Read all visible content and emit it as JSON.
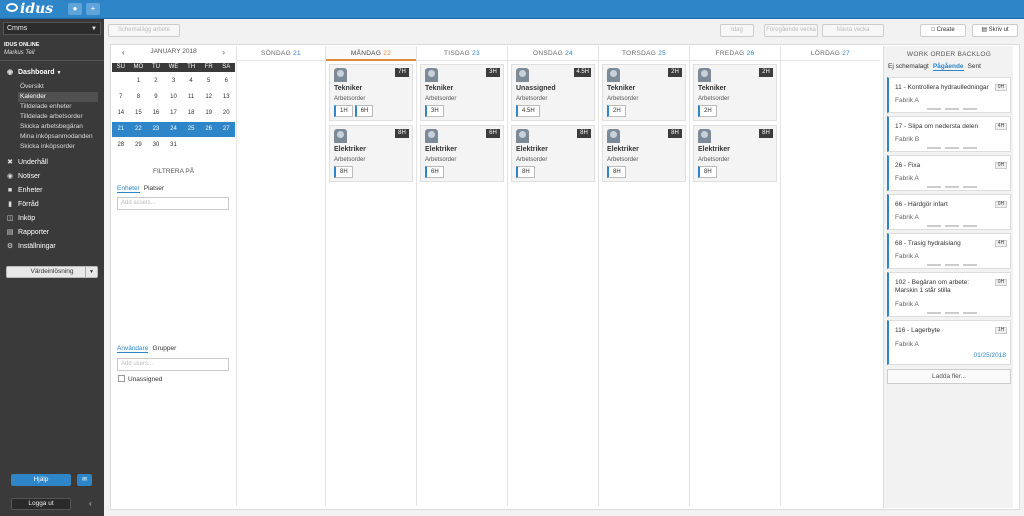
{
  "app": {
    "logo": "idus"
  },
  "sidebar": {
    "module": "Cmms",
    "org": "IDUS ONLINE",
    "user": "Markus Teil",
    "dashboard": "Dashboard",
    "subitems": [
      "Översikt",
      "Kalender",
      "Tilldelade enheter",
      "Tilldelade arbetsorder",
      "Skicka arbetsbegäran",
      "Mina inköpsanmodanden",
      "Skicka inköpsorder"
    ],
    "items": [
      {
        "label": "Underhåll",
        "icon": "tools-icon"
      },
      {
        "label": "Notiser",
        "icon": "bell-icon"
      },
      {
        "label": "Enheter",
        "icon": "assets-icon"
      },
      {
        "label": "Förråd",
        "icon": "truck-icon"
      },
      {
        "label": "Inköp",
        "icon": "cart-icon"
      },
      {
        "label": "Rapporter",
        "icon": "report-icon"
      },
      {
        "label": "Inställningar",
        "icon": "gear-icon"
      }
    ],
    "value_button": "Värdeinlösning",
    "help": "Hjälp",
    "logout": "Logga ut"
  },
  "toolbar": {
    "left_button": "Schemalägg arbete",
    "btn_idag": "Idag",
    "btn_prev": "Föregående vecka",
    "btn_next": "Nästa vecka",
    "create": "Create",
    "print": "Skriv ut"
  },
  "calendar": {
    "month": "JANUARY 2018",
    "dow": [
      "SU",
      "MO",
      "TU",
      "WE",
      "TH",
      "FR",
      "SA"
    ],
    "weeks": [
      [
        "",
        "1",
        "2",
        "3",
        "4",
        "5",
        "6"
      ],
      [
        "7",
        "8",
        "9",
        "10",
        "11",
        "12",
        "13"
      ],
      [
        "14",
        "15",
        "16",
        "17",
        "18",
        "19",
        "20"
      ],
      [
        "21",
        "22",
        "23",
        "24",
        "25",
        "26",
        "27"
      ],
      [
        "28",
        "29",
        "30",
        "31",
        "",
        "",
        ""
      ]
    ]
  },
  "filter": {
    "title": "FILTRERA PÅ",
    "tab1": "Enheter",
    "tab2": "Platser",
    "assets_placeholder": "Add assets...",
    "tab3": "Användare",
    "tab4": "Grupper",
    "users_placeholder": "Add users...",
    "unassigned": "Unassigned"
  },
  "week": {
    "days": [
      {
        "name": "SÖNDAG",
        "num": "21"
      },
      {
        "name": "MÅNDAG",
        "num": "22"
      },
      {
        "name": "TISDAG",
        "num": "23"
      },
      {
        "name": "ONSDAG",
        "num": "24"
      },
      {
        "name": "TORSDAG",
        "num": "25"
      },
      {
        "name": "FREDAG",
        "num": "26"
      },
      {
        "name": "LÖRDAG",
        "num": "27"
      }
    ],
    "cards": {
      "mon": [
        {
          "title": "Tekniker",
          "sub": "Arbetsorder",
          "badge": "7H",
          "chips": [
            "1H",
            "6H"
          ]
        },
        {
          "title": "Elektriker",
          "sub": "Arbetsorder",
          "badge": "8H",
          "chips": [
            "8H"
          ]
        }
      ],
      "tue": [
        {
          "title": "Tekniker",
          "sub": "Arbetsorder",
          "badge": "3H",
          "chips": [
            "3H"
          ]
        },
        {
          "title": "Elektriker",
          "sub": "Arbetsorder",
          "badge": "6H",
          "chips": [
            "6H"
          ]
        }
      ],
      "wed": [
        {
          "title": "Unassigned",
          "sub": "Arbetsorder",
          "badge": "4.5H",
          "chips": [
            "4.5H"
          ]
        },
        {
          "title": "Elektriker",
          "sub": "Arbetsorder",
          "badge": "8H",
          "chips": [
            "8H"
          ]
        }
      ],
      "thu": [
        {
          "title": "Tekniker",
          "sub": "Arbetsorder",
          "badge": "2H",
          "chips": [
            "2H"
          ]
        },
        {
          "title": "Elektriker",
          "sub": "Arbetsorder",
          "badge": "8H",
          "chips": [
            "8H"
          ]
        }
      ],
      "fri": [
        {
          "title": "Tekniker",
          "sub": "Arbetsorder",
          "badge": "2H",
          "chips": [
            "2H"
          ]
        },
        {
          "title": "Elektriker",
          "sub": "Arbetsorder",
          "badge": "8H",
          "chips": [
            "8H"
          ]
        }
      ]
    }
  },
  "backlog": {
    "title": "WORK ORDER BACKLOG",
    "tabs": [
      "Ej schemalagt",
      "Pågående",
      "Sent"
    ],
    "items": [
      {
        "title": "11 - Kontrollera hydraulledningar",
        "badge": "0H",
        "factory": "Fabrik A"
      },
      {
        "title": "17 - Slipa om nedersta delen",
        "badge": "4H",
        "factory": "Fabrik B"
      },
      {
        "title": "26 - Fixa",
        "badge": "0H",
        "factory": "Fabrik A"
      },
      {
        "title": "66 - Härdgör infart",
        "badge": "0H",
        "factory": "Fabrik A"
      },
      {
        "title": "68 - Trasig hydralslang",
        "badge": "4H",
        "factory": "Fabrik A"
      },
      {
        "title": "102 - Begäran om arbete: Marskin 1 står stilla",
        "badge": "0H",
        "factory": "Fabrik A"
      },
      {
        "title": "116 - Lagerbyte",
        "badge": "1H",
        "factory": "Fabrik A",
        "date": "01/25/2018"
      }
    ],
    "load_more": "Ladda fler..."
  }
}
